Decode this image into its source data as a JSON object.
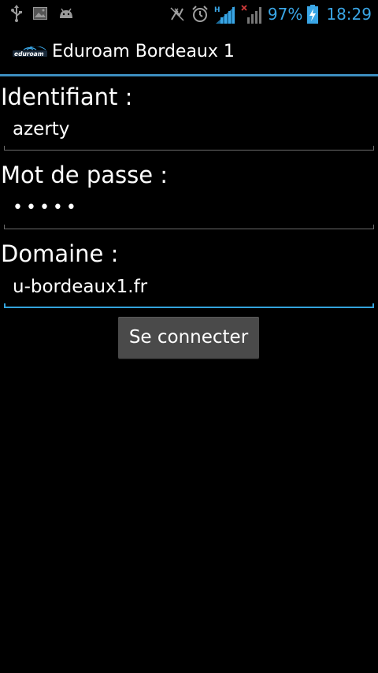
{
  "status_bar": {
    "icons_left": [
      "usb-icon",
      "screenshot-icon",
      "android-icon"
    ],
    "icons_right": [
      "no-gps-icon",
      "alarm-icon",
      "signal-h-icon",
      "signal-no-data-icon"
    ],
    "battery_percent": "97%",
    "time": "18:29",
    "accent_color": "#3aa6e6"
  },
  "app": {
    "title": "Eduroam Bordeaux 1",
    "logo_icon": "eduroam-logo-icon",
    "divider_color": "#3d8ec0"
  },
  "form": {
    "identifiant_label": "Identifiant :",
    "identifiant_value": "azerty",
    "password_label": "Mot de passe :",
    "password_value": "•••••",
    "domain_label": "Domaine :",
    "domain_value": "u-bordeaux1.fr",
    "submit_label": "Se connecter",
    "focus_color": "#33a3dc"
  }
}
